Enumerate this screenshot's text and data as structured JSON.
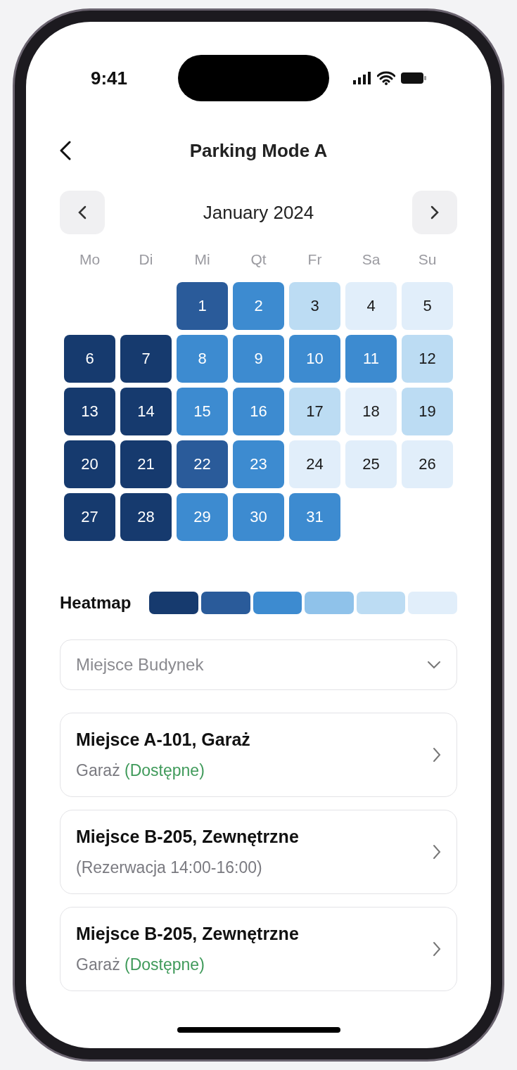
{
  "status_bar": {
    "time": "9:41"
  },
  "header": {
    "title": "Parking Mode A"
  },
  "calendar": {
    "month": "January 2024",
    "weekdays": [
      "Mo",
      "Di",
      "Mi",
      "Qt",
      "Fr",
      "Sa",
      "Su"
    ],
    "weeks": [
      {
        "days": [
          {
            "day": "1",
            "color": "#2a5b9a"
          },
          {
            "day": "2",
            "color": "#3d8bd0"
          },
          {
            "day": "3",
            "color": "#bcdcf3"
          },
          {
            "day": "4",
            "color": "#e1eefa"
          },
          {
            "day": "5",
            "color": "#e1eefa"
          }
        ]
      },
      {
        "days": [
          {
            "day": "6",
            "color": "#163a6e"
          },
          {
            "day": "7",
            "color": "#163a6e"
          },
          {
            "day": "8",
            "color": "#3d8bd0"
          },
          {
            "day": "9",
            "color": "#3d8bd0"
          },
          {
            "day": "10",
            "color": "#3d8bd0"
          },
          {
            "day": "11",
            "color": "#3d8bd0"
          },
          {
            "day": "12",
            "color": "#bcdcf3"
          }
        ]
      },
      {
        "days": [
          {
            "day": "13",
            "color": "#163a6e"
          },
          {
            "day": "14",
            "color": "#163a6e"
          },
          {
            "day": "15",
            "color": "#3d8bd0"
          },
          {
            "day": "16",
            "color": "#3d8bd0"
          },
          {
            "day": "17",
            "color": "#bcdcf3"
          },
          {
            "day": "18",
            "color": "#e1eefa"
          },
          {
            "day": "19",
            "color": "#bcdcf3"
          }
        ]
      },
      {
        "days": [
          {
            "day": "20",
            "color": "#163a6e"
          },
          {
            "day": "21",
            "color": "#163a6e"
          },
          {
            "day": "22",
            "color": "#2a5b9a"
          },
          {
            "day": "23",
            "color": "#3d8bd0"
          },
          {
            "day": "24",
            "color": "#e1eefa"
          },
          {
            "day": "25",
            "color": "#e1eefa"
          },
          {
            "day": "26",
            "color": "#e1eefa"
          }
        ]
      },
      {
        "days": [
          {
            "day": "27",
            "color": "#163a6e"
          },
          {
            "day": "28",
            "color": "#163a6e"
          },
          {
            "day": "29",
            "color": "#3d8bd0"
          },
          {
            "day": "30",
            "color": "#3d8bd0"
          },
          {
            "day": "31",
            "color": "#3d8bd0"
          }
        ]
      }
    ]
  },
  "legend": {
    "label": "Heatmap",
    "swatches": [
      {
        "color": "#163a6e"
      },
      {
        "color": "#2a5b9a"
      },
      {
        "color": "#3d8bd0"
      },
      {
        "color": "#8fc2ea"
      },
      {
        "color": "#bcdcf3"
      },
      {
        "color": "#e1eefa"
      }
    ]
  },
  "dropdown": {
    "placeholder": "Miejsce Budynek"
  },
  "spots": [
    {
      "title": "Miejsce A-101, Garaż",
      "subtitle": [
        {
          "text": "Garaż",
          "kind": "plain"
        },
        {
          "text": "(Dostępne)",
          "kind": "available"
        }
      ]
    },
    {
      "title": "Miejsce B-205, Zewnętrzne",
      "subtitle": [
        {
          "text": "(Rezerwacja 14:00-16:00)",
          "kind": "plain"
        }
      ]
    },
    {
      "title": "Miejsce B-205, Zewnętrzne",
      "subtitle": [
        {
          "text": "Garaż",
          "kind": "plain"
        },
        {
          "text": "(Dostępne)",
          "kind": "available"
        }
      ]
    }
  ]
}
